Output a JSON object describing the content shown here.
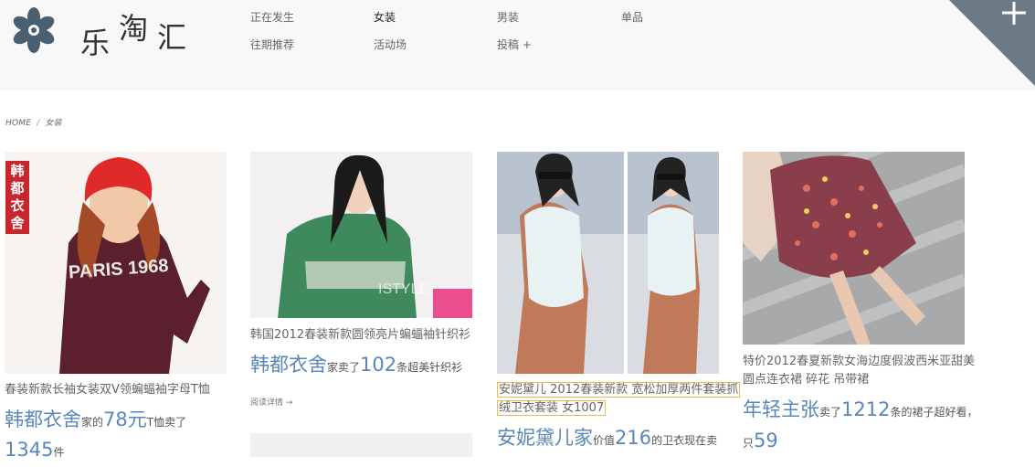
{
  "brand": {
    "chars": [
      "乐",
      "淘",
      "汇"
    ]
  },
  "nav": [
    {
      "label": "正在发生"
    },
    {
      "label": "女装"
    },
    {
      "label": "男装"
    },
    {
      "label": "单品"
    },
    {
      "label": "往期推荐"
    },
    {
      "label": "活动场"
    },
    {
      "label": "投稿 +"
    }
  ],
  "breadcrumb": {
    "home": "HOME",
    "sep": "/",
    "current": "女装"
  },
  "products": [
    {
      "badge": "韩都衣舍",
      "desc": "春装新款长袖女装双V领蝙蝠袖字母T恤",
      "shop": "韩都衣舍",
      "mid1": "家的",
      "num1": "78元",
      "mid2": "T恤卖了",
      "num2": "1345",
      "tail": "件",
      "shirt_text": "PARIS 1968"
    },
    {
      "desc": "韩国2012春装新款圆领亮片蝙蝠袖针织衫",
      "shop": "韩都衣舍",
      "mid1": "家卖了",
      "num1": "102",
      "tail": "条超美针织衫",
      "more": "阅读详情 →",
      "watermark": "ISTYLE"
    },
    {
      "desc_line1": "安妮黛儿 2012春装新款 宽松加厚两件套装抓",
      "desc_line2": "绒卫衣套装 女1007",
      "shop": "安妮黛儿家",
      "mid1": "价值",
      "num1": "216",
      "tail": "的卫衣现在卖"
    },
    {
      "desc_line1": "特价2012春夏新款女海边度假波西米亚甜美",
      "desc_line2": "圆点连衣裙 碎花 吊带裙",
      "shop": "年轻主张",
      "mid1": "卖了",
      "num1": "1212",
      "tail": "条的裙子超好看，",
      "mid2": "只",
      "num2": "59"
    }
  ],
  "colors": {
    "accent": "#5a86b8",
    "badge": "#c9252c",
    "highlight": "#f0b84a",
    "corner": "#6b7a85"
  },
  "icons": [
    "flower-logo-icon",
    "plus-icon"
  ]
}
